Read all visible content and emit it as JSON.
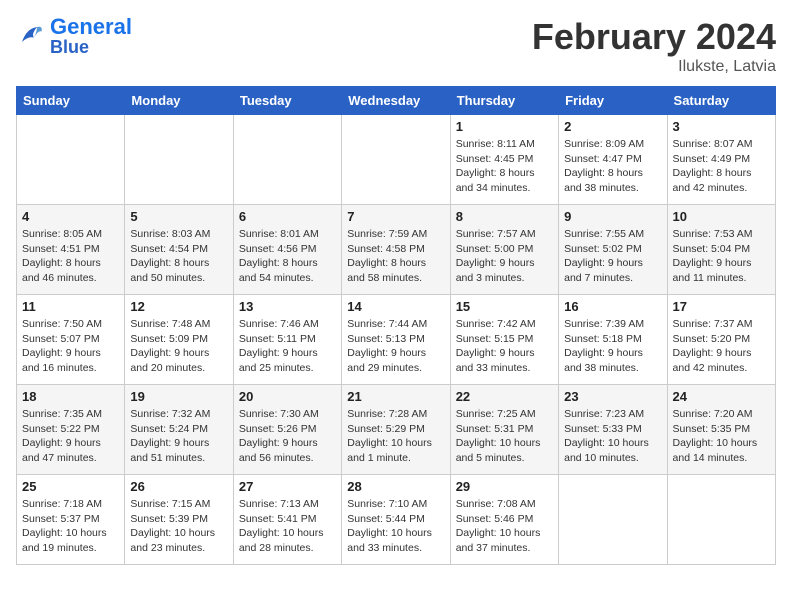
{
  "header": {
    "logo_general": "General",
    "logo_blue": "Blue",
    "month_title": "February 2024",
    "location": "Ilukste, Latvia"
  },
  "days_of_week": [
    "Sunday",
    "Monday",
    "Tuesday",
    "Wednesday",
    "Thursday",
    "Friday",
    "Saturday"
  ],
  "weeks": [
    [
      {
        "day": "",
        "info": ""
      },
      {
        "day": "",
        "info": ""
      },
      {
        "day": "",
        "info": ""
      },
      {
        "day": "",
        "info": ""
      },
      {
        "day": "1",
        "info": "Sunrise: 8:11 AM\nSunset: 4:45 PM\nDaylight: 8 hours\nand 34 minutes."
      },
      {
        "day": "2",
        "info": "Sunrise: 8:09 AM\nSunset: 4:47 PM\nDaylight: 8 hours\nand 38 minutes."
      },
      {
        "day": "3",
        "info": "Sunrise: 8:07 AM\nSunset: 4:49 PM\nDaylight: 8 hours\nand 42 minutes."
      }
    ],
    [
      {
        "day": "4",
        "info": "Sunrise: 8:05 AM\nSunset: 4:51 PM\nDaylight: 8 hours\nand 46 minutes."
      },
      {
        "day": "5",
        "info": "Sunrise: 8:03 AM\nSunset: 4:54 PM\nDaylight: 8 hours\nand 50 minutes."
      },
      {
        "day": "6",
        "info": "Sunrise: 8:01 AM\nSunset: 4:56 PM\nDaylight: 8 hours\nand 54 minutes."
      },
      {
        "day": "7",
        "info": "Sunrise: 7:59 AM\nSunset: 4:58 PM\nDaylight: 8 hours\nand 58 minutes."
      },
      {
        "day": "8",
        "info": "Sunrise: 7:57 AM\nSunset: 5:00 PM\nDaylight: 9 hours\nand 3 minutes."
      },
      {
        "day": "9",
        "info": "Sunrise: 7:55 AM\nSunset: 5:02 PM\nDaylight: 9 hours\nand 7 minutes."
      },
      {
        "day": "10",
        "info": "Sunrise: 7:53 AM\nSunset: 5:04 PM\nDaylight: 9 hours\nand 11 minutes."
      }
    ],
    [
      {
        "day": "11",
        "info": "Sunrise: 7:50 AM\nSunset: 5:07 PM\nDaylight: 9 hours\nand 16 minutes."
      },
      {
        "day": "12",
        "info": "Sunrise: 7:48 AM\nSunset: 5:09 PM\nDaylight: 9 hours\nand 20 minutes."
      },
      {
        "day": "13",
        "info": "Sunrise: 7:46 AM\nSunset: 5:11 PM\nDaylight: 9 hours\nand 25 minutes."
      },
      {
        "day": "14",
        "info": "Sunrise: 7:44 AM\nSunset: 5:13 PM\nDaylight: 9 hours\nand 29 minutes."
      },
      {
        "day": "15",
        "info": "Sunrise: 7:42 AM\nSunset: 5:15 PM\nDaylight: 9 hours\nand 33 minutes."
      },
      {
        "day": "16",
        "info": "Sunrise: 7:39 AM\nSunset: 5:18 PM\nDaylight: 9 hours\nand 38 minutes."
      },
      {
        "day": "17",
        "info": "Sunrise: 7:37 AM\nSunset: 5:20 PM\nDaylight: 9 hours\nand 42 minutes."
      }
    ],
    [
      {
        "day": "18",
        "info": "Sunrise: 7:35 AM\nSunset: 5:22 PM\nDaylight: 9 hours\nand 47 minutes."
      },
      {
        "day": "19",
        "info": "Sunrise: 7:32 AM\nSunset: 5:24 PM\nDaylight: 9 hours\nand 51 minutes."
      },
      {
        "day": "20",
        "info": "Sunrise: 7:30 AM\nSunset: 5:26 PM\nDaylight: 9 hours\nand 56 minutes."
      },
      {
        "day": "21",
        "info": "Sunrise: 7:28 AM\nSunset: 5:29 PM\nDaylight: 10 hours\nand 1 minute."
      },
      {
        "day": "22",
        "info": "Sunrise: 7:25 AM\nSunset: 5:31 PM\nDaylight: 10 hours\nand 5 minutes."
      },
      {
        "day": "23",
        "info": "Sunrise: 7:23 AM\nSunset: 5:33 PM\nDaylight: 10 hours\nand 10 minutes."
      },
      {
        "day": "24",
        "info": "Sunrise: 7:20 AM\nSunset: 5:35 PM\nDaylight: 10 hours\nand 14 minutes."
      }
    ],
    [
      {
        "day": "25",
        "info": "Sunrise: 7:18 AM\nSunset: 5:37 PM\nDaylight: 10 hours\nand 19 minutes."
      },
      {
        "day": "26",
        "info": "Sunrise: 7:15 AM\nSunset: 5:39 PM\nDaylight: 10 hours\nand 23 minutes."
      },
      {
        "day": "27",
        "info": "Sunrise: 7:13 AM\nSunset: 5:41 PM\nDaylight: 10 hours\nand 28 minutes."
      },
      {
        "day": "28",
        "info": "Sunrise: 7:10 AM\nSunset: 5:44 PM\nDaylight: 10 hours\nand 33 minutes."
      },
      {
        "day": "29",
        "info": "Sunrise: 7:08 AM\nSunset: 5:46 PM\nDaylight: 10 hours\nand 37 minutes."
      },
      {
        "day": "",
        "info": ""
      },
      {
        "day": "",
        "info": ""
      }
    ]
  ]
}
